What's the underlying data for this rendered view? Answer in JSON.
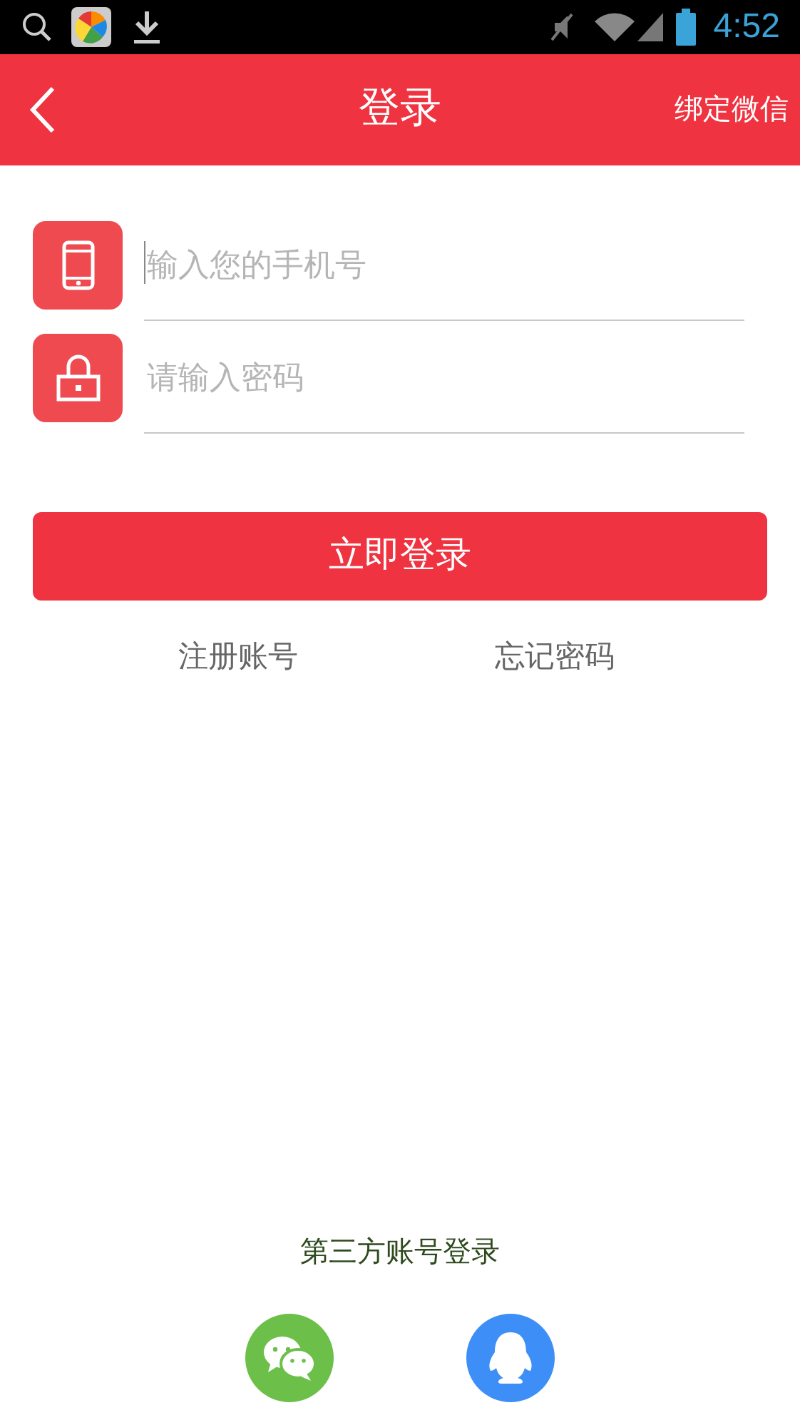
{
  "status_bar": {
    "time": "4:52"
  },
  "header": {
    "title": "登录",
    "action": "绑定微信"
  },
  "fields": [
    {
      "kind": "phone",
      "placeholder": "输入您的手机号",
      "focused": true
    },
    {
      "kind": "password",
      "placeholder": "请输入密码",
      "focused": false
    }
  ],
  "login_button": "立即登录",
  "links": [
    "注册账号",
    "忘记密码"
  ],
  "third_party": {
    "title": "第三方账号登录",
    "providers": [
      {
        "kind": "chat",
        "color": "#6cc04a"
      },
      {
        "kind": "penguin",
        "color": "#3e8ef7"
      }
    ]
  }
}
